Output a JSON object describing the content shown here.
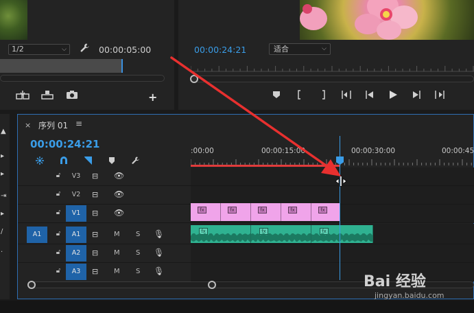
{
  "source_monitor": {
    "resolution": "1/2",
    "timecode": "00:00:05:00",
    "icons": [
      "insert-icon",
      "overwrite-icon",
      "camera-icon"
    ],
    "add": "+"
  },
  "program_monitor": {
    "timecode": "00:00:24:21",
    "fit": "适合",
    "controls": [
      "marker-icon",
      "mark-in-icon",
      "mark-out-icon",
      "go-to-in-icon",
      "step-back-icon",
      "play-icon",
      "step-forward-icon",
      "go-to-out-icon"
    ]
  },
  "timeline": {
    "close": "×",
    "title": "序列 01",
    "menu": "≡",
    "timecode": "00:00:24:21",
    "ruler_labels": [
      ":00:00",
      "00:00:15:00",
      "00:00:30:00",
      "00:00:45"
    ],
    "tracks": {
      "v3": {
        "name": "V3"
      },
      "v2": {
        "name": "V2"
      },
      "v1": {
        "name": "V1"
      },
      "a1": {
        "source": "A1",
        "name": "A1",
        "mute": "M",
        "solo": "S"
      },
      "a2": {
        "name": "A2",
        "mute": "M",
        "solo": "S"
      },
      "a3": {
        "name": "A3",
        "mute": "M",
        "solo": "S"
      }
    },
    "fx_badge": "fx"
  },
  "colors": {
    "accent": "#3a9de8",
    "video_clip": "#f0a4ea",
    "audio_clip": "#2fb291",
    "annotation_arrow": "#e8302f"
  },
  "watermark": {
    "logo": "Bai 经验",
    "url": "jingyan.baidu.com"
  }
}
